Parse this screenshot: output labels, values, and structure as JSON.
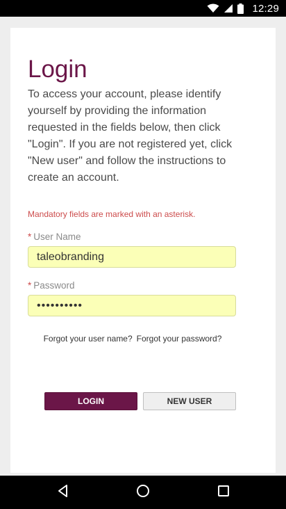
{
  "status_bar": {
    "time": "12:29",
    "icons": [
      "wifi-icon",
      "cell-signal-icon",
      "battery-icon"
    ]
  },
  "login": {
    "title": "Login",
    "intro": "To access your account, please identify yourself by providing the information requested in the fields below, then click \"Login\". If you are not registered yet, click \"New user\" and follow the instructions to create an account.",
    "mandatory_note": "Mandatory fields are marked with an asterisk.",
    "username": {
      "asterisk": "*",
      "label": "User Name",
      "value": "taleobranding"
    },
    "password": {
      "asterisk": "*",
      "label": "Password",
      "value": "••••••••••"
    },
    "forgot_username": "Forgot your user name?",
    "forgot_password": "Forgot your password?",
    "login_button": "LOGIN",
    "new_user_button": "NEW USER"
  },
  "colors": {
    "brand": "#6b1648",
    "required": "#cc4b4b",
    "field_background": "#fbffb7"
  },
  "nav_bar": {
    "icons": [
      "back-icon",
      "home-icon",
      "recents-icon"
    ]
  }
}
